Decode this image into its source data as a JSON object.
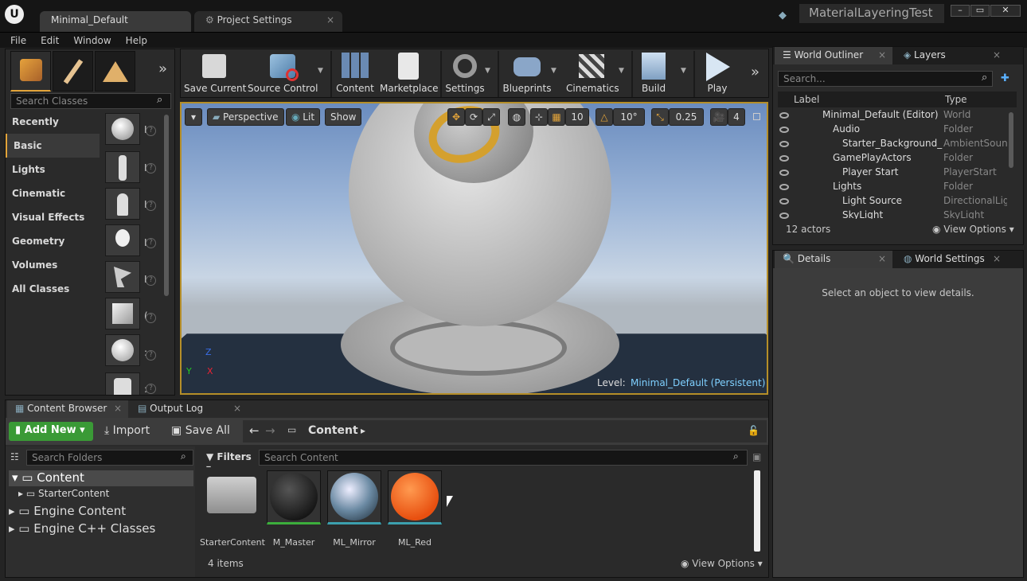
{
  "window": {
    "tabs": [
      "Minimal_Default",
      "Project Settings"
    ],
    "project_name": "MaterialLayeringTest"
  },
  "menu": [
    "File",
    "Edit",
    "Window",
    "Help"
  ],
  "modes": {
    "search_placeholder": "Search Classes",
    "categories": [
      "Recently Placed",
      "Basic",
      "Lights",
      "Cinematic",
      "Visual Effects",
      "Geometry",
      "Volumes",
      "All Classes"
    ],
    "selected": "Basic",
    "item_marks": [
      "I",
      "I",
      "I",
      "I",
      "I",
      "(",
      ":",
      ":"
    ]
  },
  "toolbar": {
    "buttons": [
      "Save Current",
      "Source Control",
      "Content",
      "Marketplace",
      "Settings",
      "Blueprints",
      "Cinematics",
      "Build",
      "Play"
    ]
  },
  "viewport": {
    "perspective": "Perspective",
    "lit": "Lit",
    "show": "Show",
    "grid_snap": "10",
    "rot_snap": "10°",
    "scale_snap": "0.25",
    "cam_speed": "4",
    "level_label": "Level:",
    "level_name": "Minimal_Default (Persistent)",
    "axis_z": "Z",
    "axis_x": "X",
    "axis_y": "Y"
  },
  "outliner": {
    "tab": "World Outliner",
    "tab2": "Layers",
    "search_placeholder": "Search...",
    "col_label": "Label",
    "col_type": "Type",
    "rows": [
      {
        "label": "Minimal_Default (Editor)",
        "type": "World"
      },
      {
        "label": "Audio",
        "type": "Folder"
      },
      {
        "label": "Starter_Background_Cu",
        "type": "AmbientSound"
      },
      {
        "label": "GamePlayActors",
        "type": "Folder"
      },
      {
        "label": "Player Start",
        "type": "PlayerStart"
      },
      {
        "label": "Lights",
        "type": "Folder"
      },
      {
        "label": "Light Source",
        "type": "DirectionalLigl"
      },
      {
        "label": "SkyLight",
        "type": "SkyLight"
      }
    ],
    "actor_count": "12 actors",
    "view_options": "View Options"
  },
  "details": {
    "tab": "Details",
    "tab2": "World Settings",
    "empty_msg": "Select an object to view details."
  },
  "content_browser": {
    "tab": "Content Browser",
    "tab2": "Output Log",
    "add_new": "Add New",
    "import": "Import",
    "save_all": "Save All",
    "path": "Content",
    "search_folders": "Search Folders",
    "filters": "Filters",
    "search_content": "Search Content",
    "folders": [
      "Content",
      "StarterContent",
      "Engine Content",
      "Engine C++ Classes"
    ],
    "assets": [
      "StarterContent",
      "M_Master",
      "ML_Mirror",
      "ML_Red"
    ],
    "item_count": "4 items",
    "view_options": "View Options"
  }
}
